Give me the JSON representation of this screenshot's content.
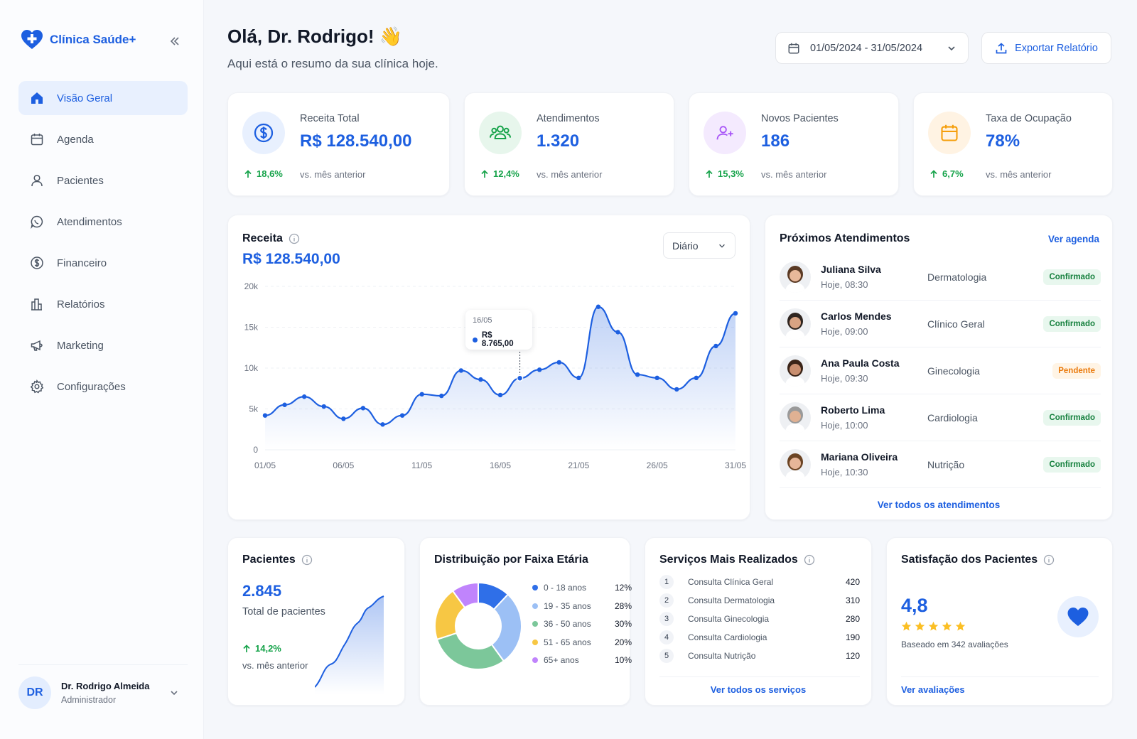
{
  "brand": {
    "name": "Clínica Saúde+"
  },
  "nav": [
    {
      "label": "Visão Geral",
      "icon": "home-icon"
    },
    {
      "label": "Agenda",
      "icon": "calendar-icon"
    },
    {
      "label": "Pacientes",
      "icon": "user-icon"
    },
    {
      "label": "Atendimentos",
      "icon": "chat-icon"
    },
    {
      "label": "Financeiro",
      "icon": "dollar-icon"
    },
    {
      "label": "Relatórios",
      "icon": "report-icon"
    },
    {
      "label": "Marketing",
      "icon": "megaphone-icon"
    },
    {
      "label": "Configurações",
      "icon": "gear-icon"
    }
  ],
  "user": {
    "initials": "DR",
    "name": "Dr. Rodrigo Almeida",
    "role": "Administrador"
  },
  "header": {
    "greeting": "Olá, Dr. Rodrigo! 👋",
    "subtitle": "Aqui está o resumo da sua clínica hoje.",
    "date_range": "01/05/2024 - 31/05/2024",
    "export_label": "Exportar Relatório"
  },
  "kpis": [
    {
      "label": "Receita Total",
      "value": "R$ 128.540,00",
      "delta": "18,6%",
      "note": "vs. mês anterior",
      "color": "#1d5fe0",
      "bg": "#e8f0fe"
    },
    {
      "label": "Atendimentos",
      "value": "1.320",
      "delta": "12,4%",
      "note": "vs. mês anterior",
      "color": "#16a34a",
      "bg": "#e7f6ec"
    },
    {
      "label": "Novos Pacientes",
      "value": "186",
      "delta": "15,3%",
      "note": "vs. mês anterior",
      "color": "#a855f7",
      "bg": "#f4eafe"
    },
    {
      "label": "Taxa de Ocupação",
      "value": "78%",
      "delta": "6,7%",
      "note": "vs. mês anterior",
      "color": "#f59e0b",
      "bg": "#fff3e3"
    }
  ],
  "revenue": {
    "title": "Receita",
    "total": "R$ 128.540,00",
    "period": "Diário",
    "tooltip": {
      "date": "16/05",
      "value": "R$ 8.765,00"
    }
  },
  "chart_data": {
    "type": "area",
    "x": [
      1,
      2,
      3,
      4,
      5,
      6,
      7,
      8,
      9,
      10,
      11,
      12,
      13,
      14,
      15,
      16,
      17,
      18,
      19,
      20,
      21,
      22,
      23,
      24,
      25,
      26,
      27,
      28,
      29,
      30,
      31
    ],
    "x_tick_labels": [
      "01/05",
      "06/05",
      "11/05",
      "16/05",
      "21/05",
      "26/05",
      "31/05"
    ],
    "y": [
      4200,
      5500,
      6500,
      5300,
      3800,
      5100,
      3100,
      4200,
      6800,
      6600,
      9700,
      8600,
      6700,
      8765,
      9800,
      10700,
      8800,
      17500,
      14400,
      9200,
      8800,
      7400,
      8800,
      12700,
      16700
    ],
    "y_ticks": [
      "0",
      "5k",
      "10k",
      "15k",
      "20k"
    ],
    "ylim": [
      0,
      20000
    ],
    "color": "#1d5fe0"
  },
  "appointments": {
    "title": "Próximos Atendimentos",
    "link": "Ver agenda",
    "footer": "Ver todos os atendimentos",
    "items": [
      {
        "name": "Juliana Silva",
        "time": "Hoje, 08:30",
        "specialty": "Dermatologia",
        "status": "Confirmado"
      },
      {
        "name": "Carlos Mendes",
        "time": "Hoje, 09:00",
        "specialty": "Clínico Geral",
        "status": "Confirmado"
      },
      {
        "name": "Ana Paula Costa",
        "time": "Hoje, 09:30",
        "specialty": "Ginecologia",
        "status": "Pendente"
      },
      {
        "name": "Roberto Lima",
        "time": "Hoje, 10:00",
        "specialty": "Cardiologia",
        "status": "Confirmado"
      },
      {
        "name": "Mariana Oliveira",
        "time": "Hoje, 10:30",
        "specialty": "Nutrição",
        "status": "Confirmado"
      }
    ]
  },
  "patients": {
    "title": "Pacientes",
    "value": "2.845",
    "label": "Total de pacientes",
    "delta": "14,2%",
    "note": "vs. mês anterior"
  },
  "age": {
    "title": "Distribuição por Faixa Etária",
    "items": [
      {
        "label": "0 - 18 anos",
        "pct": "12%",
        "value": 12,
        "color": "#2f6fe8"
      },
      {
        "label": "19 - 35 anos",
        "pct": "28%",
        "value": 28,
        "color": "#9cc0f5"
      },
      {
        "label": "36 - 50 anos",
        "pct": "30%",
        "value": 30,
        "color": "#7cc79a"
      },
      {
        "label": "51 - 65 anos",
        "pct": "20%",
        "value": 20,
        "color": "#f7c744"
      },
      {
        "label": "65+ anos",
        "pct": "10%",
        "value": 10,
        "color": "#c084fc"
      }
    ]
  },
  "services": {
    "title": "Serviços Mais Realizados",
    "link": "Ver todos os serviços",
    "items": [
      {
        "rank": "1",
        "name": "Consulta Clínica Geral",
        "count": "420"
      },
      {
        "rank": "2",
        "name": "Consulta Dermatologia",
        "count": "310"
      },
      {
        "rank": "3",
        "name": "Consulta Ginecologia",
        "count": "280"
      },
      {
        "rank": "4",
        "name": "Consulta Cardiologia",
        "count": "190"
      },
      {
        "rank": "5",
        "name": "Consulta Nutrição",
        "count": "120"
      }
    ]
  },
  "satisfaction": {
    "title": "Satisfação dos Pacientes",
    "score": "4,8",
    "rating": 5,
    "basis": "Baseado em 342 avaliações",
    "link": "Ver avaliações"
  }
}
